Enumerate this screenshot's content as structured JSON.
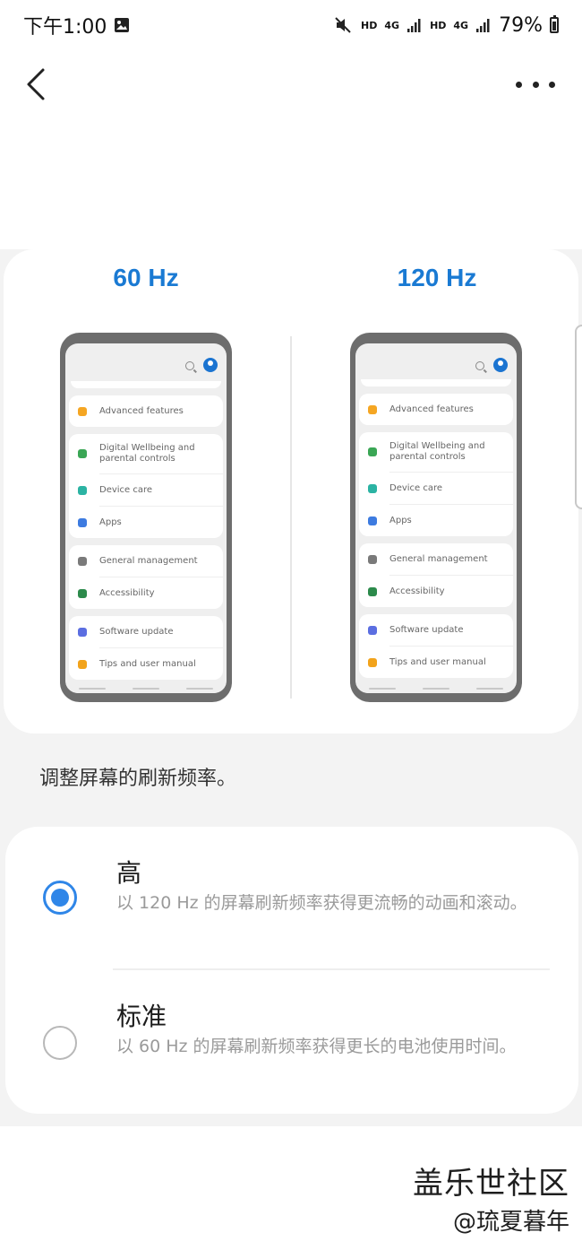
{
  "status_bar": {
    "time": "下午1:00",
    "hd1": "HD",
    "net1": "4G",
    "hd2": "HD",
    "net2": "4G",
    "battery": "79%"
  },
  "icons": [
    "back-icon",
    "more-icon",
    "gallery-icon",
    "mute-icon",
    "signal-icon",
    "battery-icon"
  ],
  "preview": {
    "left_label": "60 Hz",
    "right_label": "120 Hz",
    "menu_groups": [
      [
        {
          "label": "Advanced features",
          "color": "#f5a623"
        }
      ],
      [
        {
          "label": "Digital Wellbeing and parental controls",
          "color": "#3aa655"
        },
        {
          "label": "Device care",
          "color": "#2bb3a3"
        },
        {
          "label": "Apps",
          "color": "#3d7be0"
        }
      ],
      [
        {
          "label": "General management",
          "color": "#7a7a7a"
        },
        {
          "label": "Accessibility",
          "color": "#2c8a4b"
        }
      ],
      [
        {
          "label": "Software update",
          "color": "#5b6ee1"
        },
        {
          "label": "Tips and user manual",
          "color": "#f2a31b"
        }
      ]
    ]
  },
  "description": "调整屏幕的刷新频率。",
  "options": [
    {
      "title": "高",
      "desc": "以 120 Hz 的屏幕刷新频率获得更流畅的动画和滚动。",
      "selected": true
    },
    {
      "title": "标准",
      "desc": "以 60 Hz 的屏幕刷新频率获得更长的电池使用时间。",
      "selected": false
    }
  ],
  "watermark": {
    "line1": "盖乐世社区",
    "line2": "@琉夏暮年"
  },
  "accent_color": "#2f86e8",
  "hz_color": "#1a7ad3"
}
